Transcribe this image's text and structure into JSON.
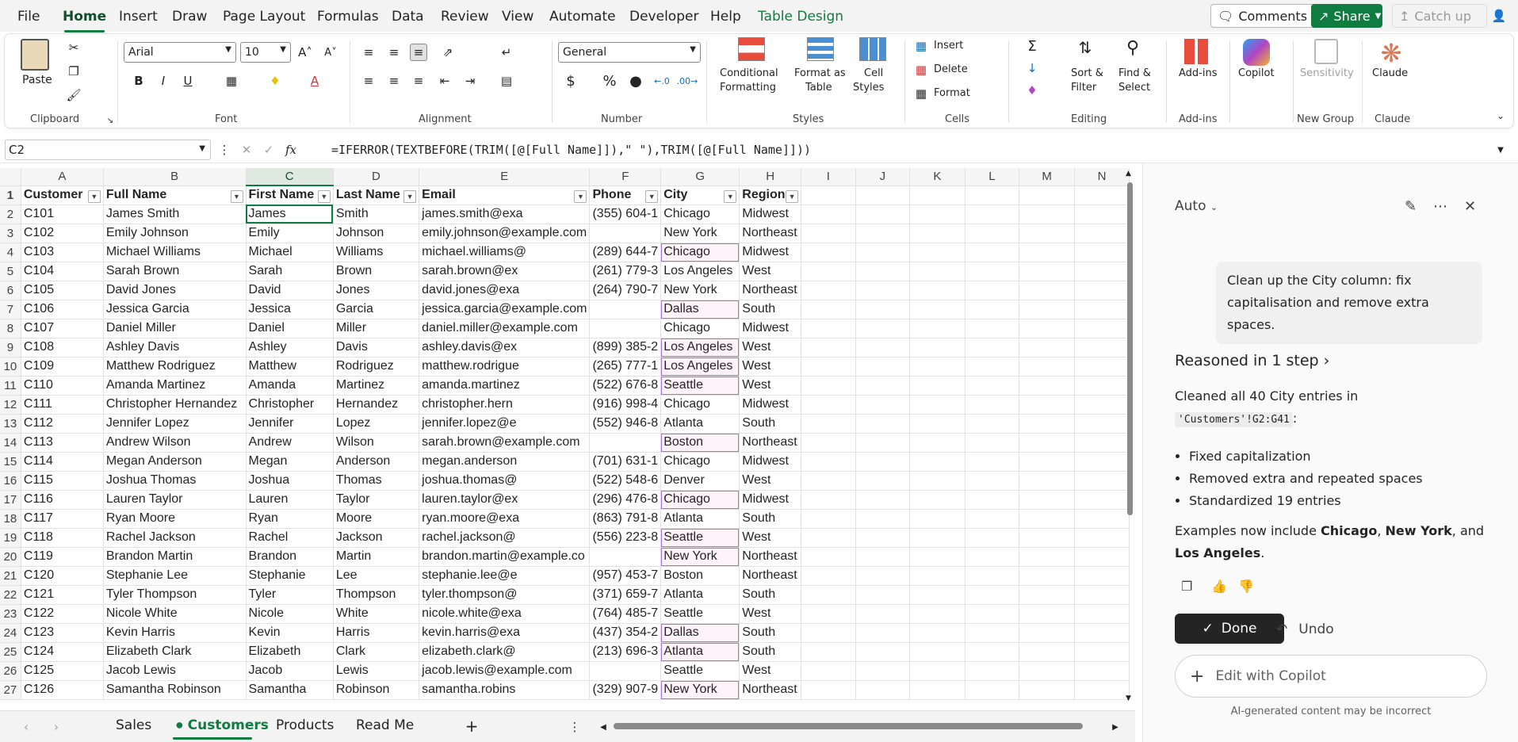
{
  "menu": {
    "tabs": [
      "File",
      "Home",
      "Insert",
      "Draw",
      "Page Layout",
      "Formulas",
      "Data",
      "Review",
      "View",
      "Automate",
      "Developer",
      "Help",
      "Table Design"
    ],
    "comments": "Comments",
    "share": "Share",
    "catchup": "Catch up"
  },
  "ribbon": {
    "clipboard": {
      "paste": "Paste",
      "label": "Clipboard"
    },
    "font": {
      "name": "Arial",
      "size": "10",
      "label": "Font"
    },
    "alignment": {
      "label": "Alignment"
    },
    "number": {
      "format": "General",
      "label": "Number",
      "percent": "%",
      "dollar": "$"
    },
    "styles": {
      "cond1": "Conditional",
      "cond2": "Formatting",
      "fmt1": "Format as",
      "fmt2": "Table",
      "cell1": "Cell",
      "cell2": "Styles",
      "label": "Styles"
    },
    "cells": {
      "insert": "Insert",
      "delete": "Delete",
      "format": "Format",
      "label": "Cells"
    },
    "editing": {
      "sort1": "Sort &",
      "sort2": "Filter",
      "find1": "Find &",
      "find2": "Select",
      "label": "Editing"
    },
    "addins": {
      "btn": "Add-ins",
      "label": "Add-ins"
    },
    "copilot": {
      "btn": "Copilot"
    },
    "newgroup": {
      "btn": "Sensitivity",
      "label": "New Group"
    },
    "claude": {
      "btn": "Claude",
      "label": "Claude"
    }
  },
  "formula_bar": {
    "name_box": "C2",
    "formula": "=IFERROR(TEXTBEFORE(TRIM([@[Full Name]]),\" \"),TRIM([@[Full Name]]))"
  },
  "sheet": {
    "columns": [
      "A",
      "B",
      "C",
      "D",
      "E",
      "F",
      "G",
      "H",
      "I",
      "J",
      "K",
      "L",
      "M",
      "N"
    ],
    "headers": [
      "Customer",
      "Full Name",
      "First Name",
      "Last Name",
      "Email",
      "Phone",
      "City",
      "Region"
    ],
    "rows": [
      [
        "2",
        "C101",
        "James Smith",
        "James",
        "Smith",
        "james.smith@exa",
        "(355) 604-1",
        "Chicago",
        "Midwest"
      ],
      [
        "3",
        "C102",
        "Emily Johnson",
        "Emily",
        "Johnson",
        "emily.johnson@example.com",
        "",
        "New York",
        "Northeast"
      ],
      [
        "4",
        "C103",
        "Michael Williams",
        "Michael",
        "Williams",
        "michael.williams@",
        "(289) 644-7",
        "Chicago",
        "Midwest"
      ],
      [
        "5",
        "C104",
        "Sarah Brown",
        "Sarah",
        "Brown",
        "sarah.brown@ex",
        "(261) 779-3",
        "Los Angeles",
        "West"
      ],
      [
        "6",
        "C105",
        "David Jones",
        "David",
        "Jones",
        "david.jones@exa",
        "(264) 790-7",
        "New York",
        "Northeast"
      ],
      [
        "7",
        "C106",
        "Jessica Garcia",
        "Jessica",
        "Garcia",
        "jessica.garcia@example.com",
        "",
        "Dallas",
        "South"
      ],
      [
        "8",
        "C107",
        "Daniel Miller",
        "Daniel",
        "Miller",
        "daniel.miller@example.com",
        "",
        "Chicago",
        "Midwest"
      ],
      [
        "9",
        "C108",
        "Ashley Davis",
        "Ashley",
        "Davis",
        "ashley.davis@ex",
        "(899) 385-2",
        "Los Angeles",
        "West"
      ],
      [
        "10",
        "C109",
        "Matthew Rodriguez",
        "Matthew",
        "Rodriguez",
        "matthew.rodrigue",
        "(265) 777-1",
        "Los Angeles",
        "West"
      ],
      [
        "11",
        "C110",
        "Amanda Martinez",
        "Amanda",
        "Martinez",
        "amanda.martinez",
        "(522) 676-8",
        "Seattle",
        "West"
      ],
      [
        "12",
        "C111",
        "Christopher Hernandez",
        "Christopher",
        "Hernandez",
        "christopher.hern",
        "(916) 998-4",
        "Chicago",
        "Midwest"
      ],
      [
        "13",
        "C112",
        "Jennifer Lopez",
        "Jennifer",
        "Lopez",
        "jennifer.lopez@e",
        "(552) 946-8",
        "Atlanta",
        "South"
      ],
      [
        "14",
        "C113",
        "Andrew Wilson",
        "Andrew",
        "Wilson",
        "sarah.brown@example.com",
        "",
        "Boston",
        "Northeast"
      ],
      [
        "15",
        "C114",
        "Megan Anderson",
        "Megan",
        "Anderson",
        "megan.anderson",
        "(701) 631-1",
        "Chicago",
        "Midwest"
      ],
      [
        "16",
        "C115",
        "Joshua Thomas",
        "Joshua",
        "Thomas",
        "joshua.thomas@",
        "(522) 548-6",
        "Denver",
        "West"
      ],
      [
        "17",
        "C116",
        "Lauren Taylor",
        "Lauren",
        "Taylor",
        "lauren.taylor@ex",
        "(296) 476-8",
        "Chicago",
        "Midwest"
      ],
      [
        "18",
        "C117",
        "Ryan Moore",
        "Ryan",
        "Moore",
        "ryan.moore@exa",
        "(863) 791-8",
        "Atlanta",
        "South"
      ],
      [
        "19",
        "C118",
        "Rachel Jackson",
        "Rachel",
        "Jackson",
        "rachel.jackson@",
        "(556) 223-8",
        "Seattle",
        "West"
      ],
      [
        "20",
        "C119",
        "Brandon Martin",
        "Brandon",
        "Martin",
        "brandon.martin@example.co",
        "",
        "New York",
        "Northeast"
      ],
      [
        "21",
        "C120",
        "Stephanie Lee",
        "Stephanie",
        "Lee",
        "stephanie.lee@e",
        "(957) 453-7",
        "Boston",
        "Northeast"
      ],
      [
        "22",
        "C121",
        "Tyler Thompson",
        "Tyler",
        "Thompson",
        "tyler.thompson@",
        "(371) 659-7",
        "Atlanta",
        "South"
      ],
      [
        "23",
        "C122",
        "Nicole White",
        "Nicole",
        "White",
        "nicole.white@exa",
        "(764) 485-7",
        "Seattle",
        "West"
      ],
      [
        "24",
        "C123",
        "Kevin Harris",
        "Kevin",
        "Harris",
        "kevin.harris@exa",
        "(437) 354-2",
        "Dallas",
        "South"
      ],
      [
        "25",
        "C124",
        "Elizabeth Clark",
        "Elizabeth",
        "Clark",
        "elizabeth.clark@",
        "(213) 696-3",
        "Atlanta",
        "South"
      ],
      [
        "26",
        "C125",
        "Jacob Lewis",
        "Jacob",
        "Lewis",
        "jacob.lewis@example.com",
        "",
        "Seattle",
        "West"
      ],
      [
        "27",
        "C126",
        "Samantha Robinson",
        "Samantha",
        "Robinson",
        "samantha.robins",
        "(329) 907-9",
        "New York",
        "Northeast"
      ]
    ],
    "highlighted_city_rows": [
      "4",
      "7",
      "9",
      "10",
      "11",
      "14",
      "17",
      "19",
      "20",
      "24",
      "25",
      "27"
    ],
    "tabs": [
      "Sales",
      "Customers",
      "Products",
      "Read Me"
    ]
  },
  "copilot": {
    "mode": "Auto",
    "user_message": "Clean up the City column: fix capitalisation and remove extra spaces.",
    "reasoned": "Reasoned in 1 step",
    "summary_prefix": "Cleaned all 40 City entries in",
    "summary_ref": "'Customers'!G2:G41",
    "summary_suffix": ":",
    "bullets": [
      "Fixed capitalization",
      "Removed extra and repeated spaces",
      "Standardized 19 entries"
    ],
    "examples_prefix": "Examples now include",
    "ex1": "Chicago",
    "sep1": ",",
    "ex2": "New York",
    "sep2": ", and",
    "ex3": "Los Angeles",
    "period": ".",
    "done": "Done",
    "undo": "Undo",
    "edit": "Edit with Copilot",
    "disclaimer": "AI-generated content may be incorrect"
  }
}
